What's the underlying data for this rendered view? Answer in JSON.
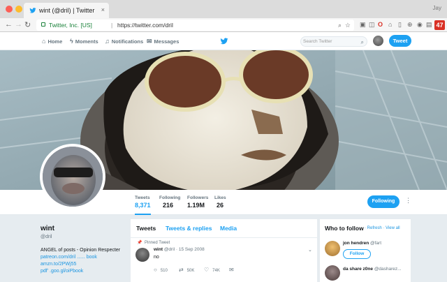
{
  "browser": {
    "tab_title": "wint (@dril) | Twitter",
    "tab_close": "×",
    "user": "Jay",
    "url_org": "Twitter, Inc. [US]",
    "url_sep": "|",
    "url": "https://twitter.com/dril",
    "back": "←",
    "forward": "→",
    "reload": "↻"
  },
  "nav": {
    "home": "Home",
    "moments": "Moments",
    "notifications": "Notifications",
    "messages": "Messages",
    "search_placeholder": "Search Twitter",
    "tweet_button": "Tweet"
  },
  "extension_badge": "47",
  "profile_nav": {
    "stats": [
      {
        "label": "Tweets",
        "value": "8,371"
      },
      {
        "label": "Following",
        "value": "216"
      },
      {
        "label": "Followers",
        "value": "1.19M"
      },
      {
        "label": "Likes",
        "value": "26"
      }
    ],
    "following_button": "Following"
  },
  "profile": {
    "name": "wint",
    "handle": "@dril",
    "bio": "ANGEL of posts - Opinion Respecter",
    "links": [
      "patreon.com/dril ...... book",
      "amzn.to/2PWj55",
      "pdf' .goo.gl/oiPbook"
    ]
  },
  "timeline": {
    "tabs": [
      "Tweets",
      "Tweets & replies",
      "Media"
    ],
    "pinned_label": "Pinned Tweet",
    "tweet": {
      "name": "wint",
      "handle": "@dril",
      "date": "· 15 Sep 2008",
      "text": "no",
      "replies": "510",
      "retweets": "50K",
      "likes": "74K"
    }
  },
  "who_to_follow": {
    "title": "Who to follow",
    "refresh": "· Refresh · View all",
    "follow_button": "Follow",
    "suggestions": [
      {
        "name": "jon hendren",
        "handle": "@fart"
      },
      {
        "name": "da share z0ne",
        "handle": "@dasharez..."
      }
    ]
  },
  "colors": {
    "accent": "#1da1f2",
    "badge": "#d93025"
  }
}
